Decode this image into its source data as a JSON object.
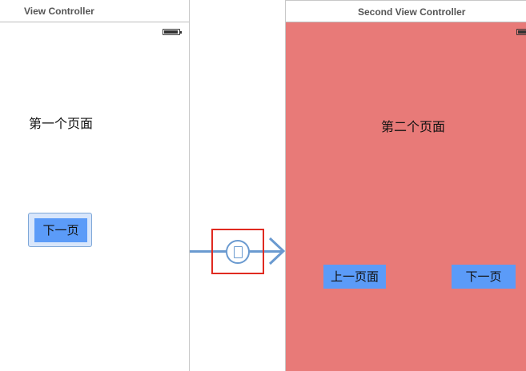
{
  "scenes": [
    {
      "title": "View Controller",
      "label": "第一个页面",
      "button": "下一页"
    },
    {
      "title": "Second View Controller",
      "label": "第二个页面",
      "buttons": [
        "上一页面",
        "下一页"
      ],
      "background": "#e87a78"
    }
  ],
  "segue": {
    "icon": "segue-modal-icon",
    "selected": true,
    "selection_color": "#e02a20",
    "line_color": "#6a9ad0"
  },
  "colors": {
    "button_blue": "#5b9bf8",
    "scene2_background": "#e87a78"
  }
}
